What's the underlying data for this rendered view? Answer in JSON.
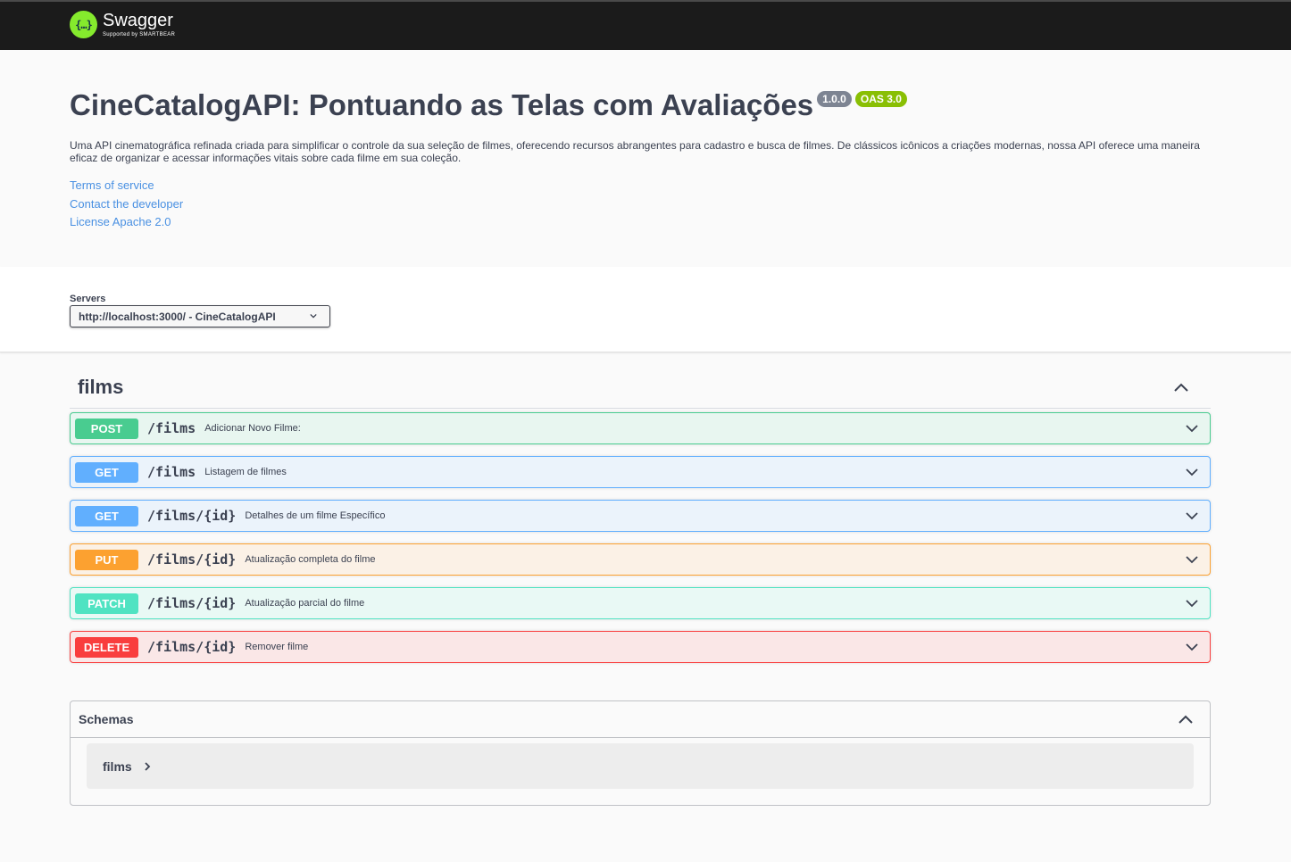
{
  "topbar": {
    "logo_name": "Swagger",
    "logo_sub": "Supported by SMARTBEAR",
    "logo_glyph": "{…}"
  },
  "info": {
    "title": "CineCatalogAPI: Pontuando as Telas com Avaliações",
    "version": "1.0.0",
    "oas": "OAS 3.0",
    "description": "Uma API cinematográfica refinada criada para simplificar o controle da sua seleção de filmes, oferecendo recursos abrangentes para cadastro e busca de filmes. De clássicos icônicos a criações modernas, nossa API oferece uma maneira eficaz de organizar e acessar informações vitais sobre cada filme em sua coleção.",
    "links": {
      "terms": "Terms of service",
      "contact": "Contact the developer",
      "license": "License Apache 2.0"
    }
  },
  "servers": {
    "label": "Servers",
    "selected": "http://localhost:3000/ - CineCatalogAPI"
  },
  "tag": {
    "name": "films",
    "operations": [
      {
        "method": "POST",
        "path": "/films",
        "summary": "Adicionar Novo Filme:"
      },
      {
        "method": "GET",
        "path": "/films",
        "summary": "Listagem de filmes"
      },
      {
        "method": "GET",
        "path": "/films/{id}",
        "summary": "Detalhes de um filme Específico"
      },
      {
        "method": "PUT",
        "path": "/films/{id}",
        "summary": "Atualização completa do filme"
      },
      {
        "method": "PATCH",
        "path": "/films/{id}",
        "summary": "Atualização parcial do filme"
      },
      {
        "method": "DELETE",
        "path": "/films/{id}",
        "summary": "Remover filme"
      }
    ]
  },
  "schemas": {
    "title": "Schemas",
    "items": [
      "films"
    ]
  },
  "colors": {
    "post": "#49cc90",
    "get": "#61affe",
    "put": "#fca130",
    "patch": "#50e3c2",
    "delete": "#f93e3e",
    "link": "#4990e2",
    "logo": "#85ea2d"
  }
}
